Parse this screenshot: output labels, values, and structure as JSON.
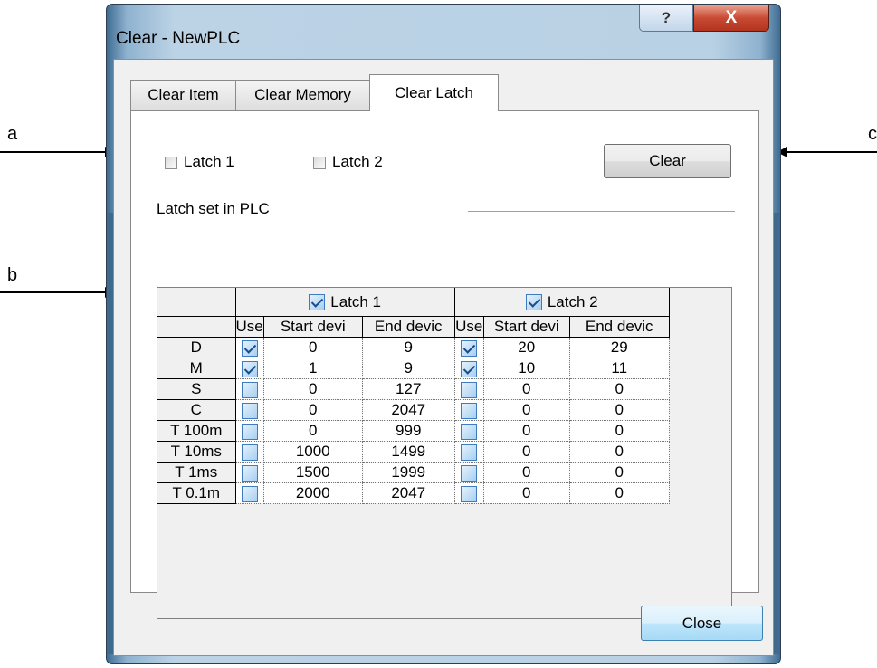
{
  "callouts": {
    "a": "a",
    "b": "b",
    "c": "c"
  },
  "window": {
    "title": "Clear - NewPLC",
    "help_label": "?",
    "close_label": "X"
  },
  "tabs": [
    {
      "label": "Clear Item",
      "active": false
    },
    {
      "label": "Clear Memory",
      "active": false
    },
    {
      "label": "Clear Latch",
      "active": true
    }
  ],
  "options": {
    "latch1_label": "Latch 1",
    "latch1_checked": false,
    "latch2_label": "Latch 2",
    "latch2_checked": false,
    "clear_button": "Clear",
    "section_label": "Latch set in  PLC"
  },
  "grid": {
    "group1": {
      "label": "Latch 1",
      "checked": true
    },
    "group2": {
      "label": "Latch 2",
      "checked": true
    },
    "columns": [
      "Use",
      "Start devi",
      "End devic",
      "Use",
      "Start devi",
      "End devic"
    ],
    "rows": [
      {
        "device": "D",
        "use1": true,
        "start1": "0",
        "end1": "9",
        "use2": true,
        "start2": "20",
        "end2": "29"
      },
      {
        "device": "M",
        "use1": true,
        "start1": "1",
        "end1": "9",
        "use2": true,
        "start2": "10",
        "end2": "11"
      },
      {
        "device": "S",
        "use1": false,
        "start1": "0",
        "end1": "127",
        "use2": false,
        "start2": "0",
        "end2": "0"
      },
      {
        "device": "C",
        "use1": false,
        "start1": "0",
        "end1": "2047",
        "use2": false,
        "start2": "0",
        "end2": "0"
      },
      {
        "device": "T 100m",
        "use1": false,
        "start1": "0",
        "end1": "999",
        "use2": false,
        "start2": "0",
        "end2": "0"
      },
      {
        "device": "T 10ms",
        "use1": false,
        "start1": "1000",
        "end1": "1499",
        "use2": false,
        "start2": "0",
        "end2": "0"
      },
      {
        "device": "T 1ms",
        "use1": false,
        "start1": "1500",
        "end1": "1999",
        "use2": false,
        "start2": "0",
        "end2": "0"
      },
      {
        "device": "T 0.1m",
        "use1": false,
        "start1": "2000",
        "end1": "2047",
        "use2": false,
        "start2": "0",
        "end2": "0"
      }
    ]
  },
  "footer": {
    "close_button": "Close"
  },
  "colors": {
    "titlebar": "#b9d1e4",
    "close_x": "#c94a33",
    "checkbox": "#3d7cc1"
  }
}
